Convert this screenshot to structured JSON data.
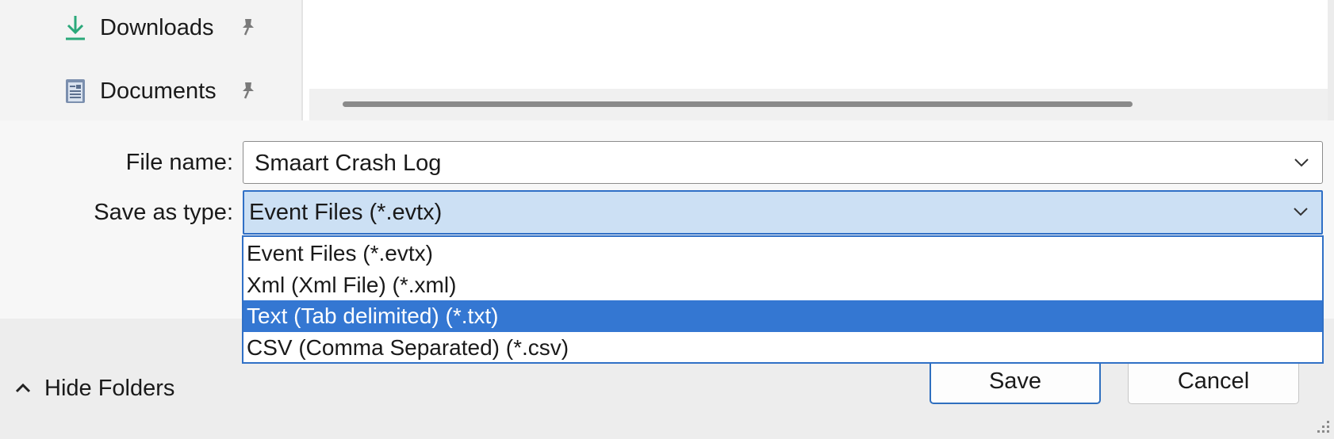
{
  "nav": {
    "items": [
      {
        "label": "Downloads",
        "icon": "download-icon"
      },
      {
        "label": "Documents",
        "icon": "document-icon"
      }
    ]
  },
  "form": {
    "filename_label": "File name:",
    "filename_value": "Smaart Crash Log",
    "savetype_label": "Save as type:",
    "savetype_value": "Event Files (*.evtx)"
  },
  "dropdown": {
    "options": [
      "Event Files (*.evtx)",
      "Xml (Xml File) (*.xml)",
      "Text (Tab delimited) (*.txt)",
      "CSV (Comma Separated) (*.csv)"
    ],
    "highlighted": "Text (Tab delimited) (*.txt)"
  },
  "footer": {
    "hide_folders_label": "Hide Folders",
    "save_label": "Save",
    "cancel_label": "Cancel"
  },
  "colors": {
    "accent": "#3477d2",
    "select_bg": "#cce0f4",
    "download_icon": "#2aa87a"
  }
}
